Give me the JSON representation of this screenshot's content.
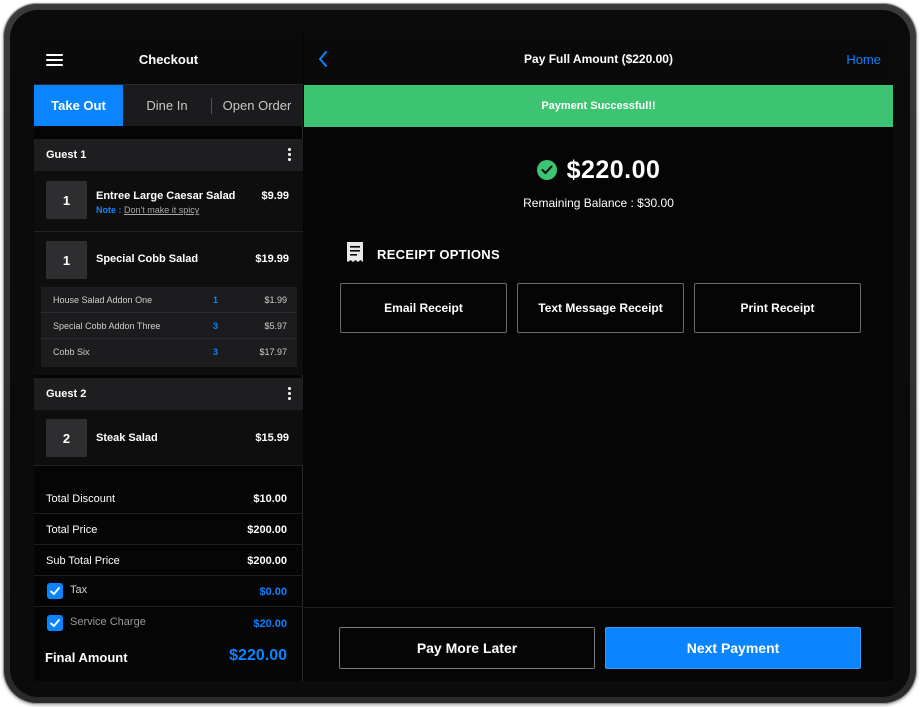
{
  "left": {
    "title": "Checkout",
    "tabs": [
      {
        "label": "Take Out",
        "active": true
      },
      {
        "label": "Dine In",
        "active": false
      },
      {
        "label": "Open Order",
        "active": false
      }
    ],
    "guests": [
      {
        "label": "Guest 1",
        "items": [
          {
            "qty": "1",
            "name": "Entree Large Caesar Salad",
            "price": "$9.99",
            "note_label": "Note :",
            "note_text": "Don't make it spicy"
          },
          {
            "qty": "1",
            "name": "Special Cobb Salad",
            "price": "$19.99",
            "addons": [
              {
                "name": "House Salad Addon One",
                "qty": "1",
                "price": "$1.99"
              },
              {
                "name": "Special Cobb Addon Three",
                "qty": "3",
                "price": "$5.97"
              },
              {
                "name": "Cobb Six",
                "qty": "3",
                "price": "$17.97"
              }
            ]
          }
        ]
      },
      {
        "label": "Guest 2",
        "items": [
          {
            "qty": "2",
            "name": "Steak Salad",
            "price": "$15.99"
          }
        ]
      }
    ],
    "totals": {
      "discount": {
        "label": "Total Discount",
        "value": "$10.00"
      },
      "total_price": {
        "label": "Total Price",
        "value": "$200.00"
      },
      "sub_total": {
        "label": "Sub Total Price",
        "value": "$200.00"
      },
      "tax": {
        "label": "Tax",
        "value": "$0.00",
        "checked": true
      },
      "service": {
        "label": "Service Charge",
        "value": "$20.00",
        "checked": true
      },
      "final": {
        "label": "Final Amount",
        "value": "$220.00"
      }
    }
  },
  "right": {
    "title": "Pay Full Amount ($220.00)",
    "home_label": "Home",
    "success_message": "Payment Successful!!",
    "amount": "$220.00",
    "remaining": "Remaining Balance : $30.00",
    "receipt_heading": "RECEIPT OPTIONS",
    "receipt_buttons": [
      "Email Receipt",
      "Text Message Receipt",
      "Print Receipt"
    ],
    "footer": {
      "pay_later": "Pay More Later",
      "next_payment": "Next Payment"
    }
  },
  "colors": {
    "accent": "#0a84ff",
    "success": "#3cc472",
    "background": "#050505"
  },
  "icons": [
    "hamburger-icon",
    "kebab-icon",
    "back-chevron-icon",
    "check-circle-icon",
    "receipt-icon",
    "checkbox-checked-icon"
  ]
}
